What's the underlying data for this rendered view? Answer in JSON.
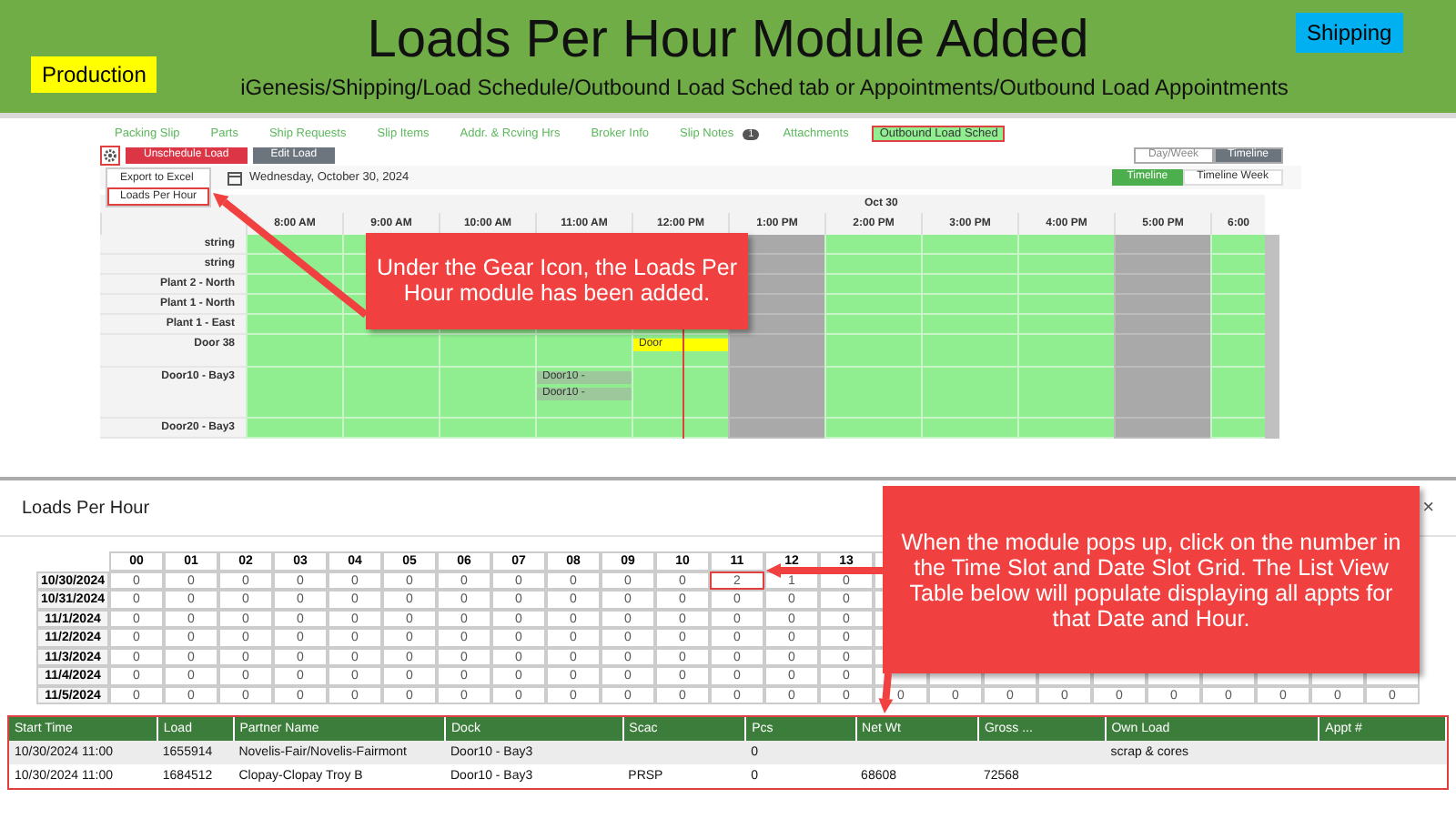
{
  "header": {
    "title": "Loads Per Hour Module Added",
    "path": "iGenesis/Shipping/Load Schedule/Outbound Load Sched tab or Appointments/Outbound Load Appointments",
    "left_badge": {
      "label": "Production",
      "color": "#ffff00"
    },
    "right_badge": {
      "label": "Shipping",
      "color": "#00b0f0"
    }
  },
  "scheduler": {
    "tabs": [
      {
        "label": "Packing Slip",
        "selected": false
      },
      {
        "label": "Parts",
        "selected": false
      },
      {
        "label": "Ship Requests",
        "selected": false
      },
      {
        "label": "Slip Items",
        "selected": false
      },
      {
        "label": "Addr. & Rcving Hrs",
        "selected": false
      },
      {
        "label": "Broker Info",
        "selected": false
      },
      {
        "label": "Slip Notes",
        "selected": false,
        "badge": "1"
      },
      {
        "label": "Attachments",
        "selected": false
      },
      {
        "label": "Outbound Load Sched",
        "selected": true
      }
    ],
    "gear_highlighted": true,
    "buttons": [
      {
        "label": "Unschedule Load",
        "kind": "danger"
      },
      {
        "label": "Edit Load",
        "kind": "secondary"
      }
    ],
    "menu": [
      {
        "label": "Export to Excel",
        "highlighted": false
      },
      {
        "label": "Loads Per Hour",
        "highlighted": true
      }
    ],
    "view_toggle": [
      {
        "label": "Day/Week",
        "selected": false
      },
      {
        "label": "Timeline",
        "selected": true
      }
    ],
    "date": "Wednesday, October 30, 2024",
    "timeline_toggle": [
      {
        "label": "Timeline",
        "selected": true
      },
      {
        "label": "Timeline Week",
        "selected": false
      }
    ],
    "day_label": "Oct 30",
    "hours": [
      {
        "label": "8:00 AM",
        "closed": false
      },
      {
        "label": "9:00 AM",
        "closed": false
      },
      {
        "label": "10:00 AM",
        "closed": false
      },
      {
        "label": "11:00 AM",
        "closed": false
      },
      {
        "label": "12:00 PM",
        "closed": false
      },
      {
        "label": "1:00 PM",
        "closed": true
      },
      {
        "label": "2:00 PM",
        "closed": false
      },
      {
        "label": "3:00 PM",
        "closed": false
      },
      {
        "label": "4:00 PM",
        "closed": false
      },
      {
        "label": "5:00 PM",
        "closed": true
      },
      {
        "label": "6:00",
        "closed": false
      }
    ],
    "resources": [
      {
        "name": "string"
      },
      {
        "name": "string"
      },
      {
        "name": "Plant 2 - North"
      },
      {
        "name": "Plant 1 - North"
      },
      {
        "name": "Plant 1 - East"
      },
      {
        "name": "Door 38",
        "events": [
          {
            "label": "Door",
            "color": "#ffff00"
          }
        ]
      },
      {
        "name": "Door10 - Bay3",
        "events": [
          {
            "label": "Door10 -",
            "color": "#9cc89c"
          },
          {
            "label": "Door10 -",
            "color": "#9cc89c"
          }
        ]
      },
      {
        "name": "Door20 - Bay3"
      }
    ],
    "callout": "Under the Gear Icon, the Loads Per Hour module has been added."
  },
  "loads_per_hour": {
    "title": "Loads Per Hour",
    "close": "×",
    "hours": [
      "00",
      "01",
      "02",
      "03",
      "04",
      "05",
      "06",
      "07",
      "08",
      "09",
      "10",
      "11",
      "12",
      "13"
    ],
    "rows": [
      {
        "date": "10/30/2024",
        "values": [
          "0",
          "0",
          "0",
          "0",
          "0",
          "0",
          "0",
          "0",
          "0",
          "0",
          "0",
          {
            "text": "2",
            "highlighted": true
          },
          "1",
          "0"
        ]
      },
      {
        "date": "10/31/2024",
        "values": [
          "0",
          "0",
          "0",
          "0",
          "0",
          "0",
          "0",
          "0",
          "0",
          "0",
          "0",
          "0",
          "0",
          "0"
        ]
      },
      {
        "date": "11/1/2024",
        "values": [
          "0",
          "0",
          "0",
          "0",
          "0",
          "0",
          "0",
          "0",
          "0",
          "0",
          "0",
          "0",
          "0",
          "0"
        ]
      },
      {
        "date": "11/2/2024",
        "values": [
          "0",
          "0",
          "0",
          "0",
          "0",
          "0",
          "0",
          "0",
          "0",
          "0",
          "0",
          "0",
          "0",
          "0"
        ]
      },
      {
        "date": "11/3/2024",
        "values": [
          "0",
          "0",
          "0",
          "0",
          "0",
          "0",
          "0",
          "0",
          "0",
          "0",
          "0",
          "0",
          "0",
          "0"
        ]
      },
      {
        "date": "11/4/2024",
        "values": [
          "0",
          "0",
          "0",
          "0",
          "0",
          "0",
          "0",
          "0",
          "0",
          "0",
          "0",
          "0",
          "0",
          "0"
        ]
      },
      {
        "date": "11/5/2024",
        "values": [
          "0",
          "0",
          "0",
          "0",
          "0",
          "0",
          "0",
          "0",
          "0",
          "0",
          "0",
          "0",
          "0",
          "0",
          "0",
          "0",
          "0",
          "0",
          "0",
          "0",
          "0",
          "0",
          "0",
          "0"
        ]
      }
    ],
    "list": {
      "highlighted": true,
      "columns": [
        "Start Time",
        "Load",
        "Partner Name",
        "Dock",
        "Scac",
        "Pcs",
        "Net Wt",
        "Gross ...",
        "Own Load",
        "Appt #"
      ],
      "rows": [
        {
          "selected": true,
          "start_time": "10/30/2024 11:00",
          "load": "1655914",
          "partner_name": "Novelis-Fair/Novelis-Fairmont",
          "dock": "Door10 - Bay3",
          "pcs": "0",
          "own_load": "scrap & cores"
        },
        {
          "selected": false,
          "start_time": "10/30/2024 11:00",
          "load": "1684512",
          "partner_name": "Clopay-Clopay Troy B",
          "dock": "Door10 - Bay3",
          "scac": "PRSP",
          "pcs": "0",
          "net_wt": "68608",
          "gross": "72568"
        }
      ]
    },
    "callout": "When the module pops up, click on the number in the Time Slot and Date Slot Grid. The List View Table below will populate displaying all appts for that Date and Hour."
  }
}
